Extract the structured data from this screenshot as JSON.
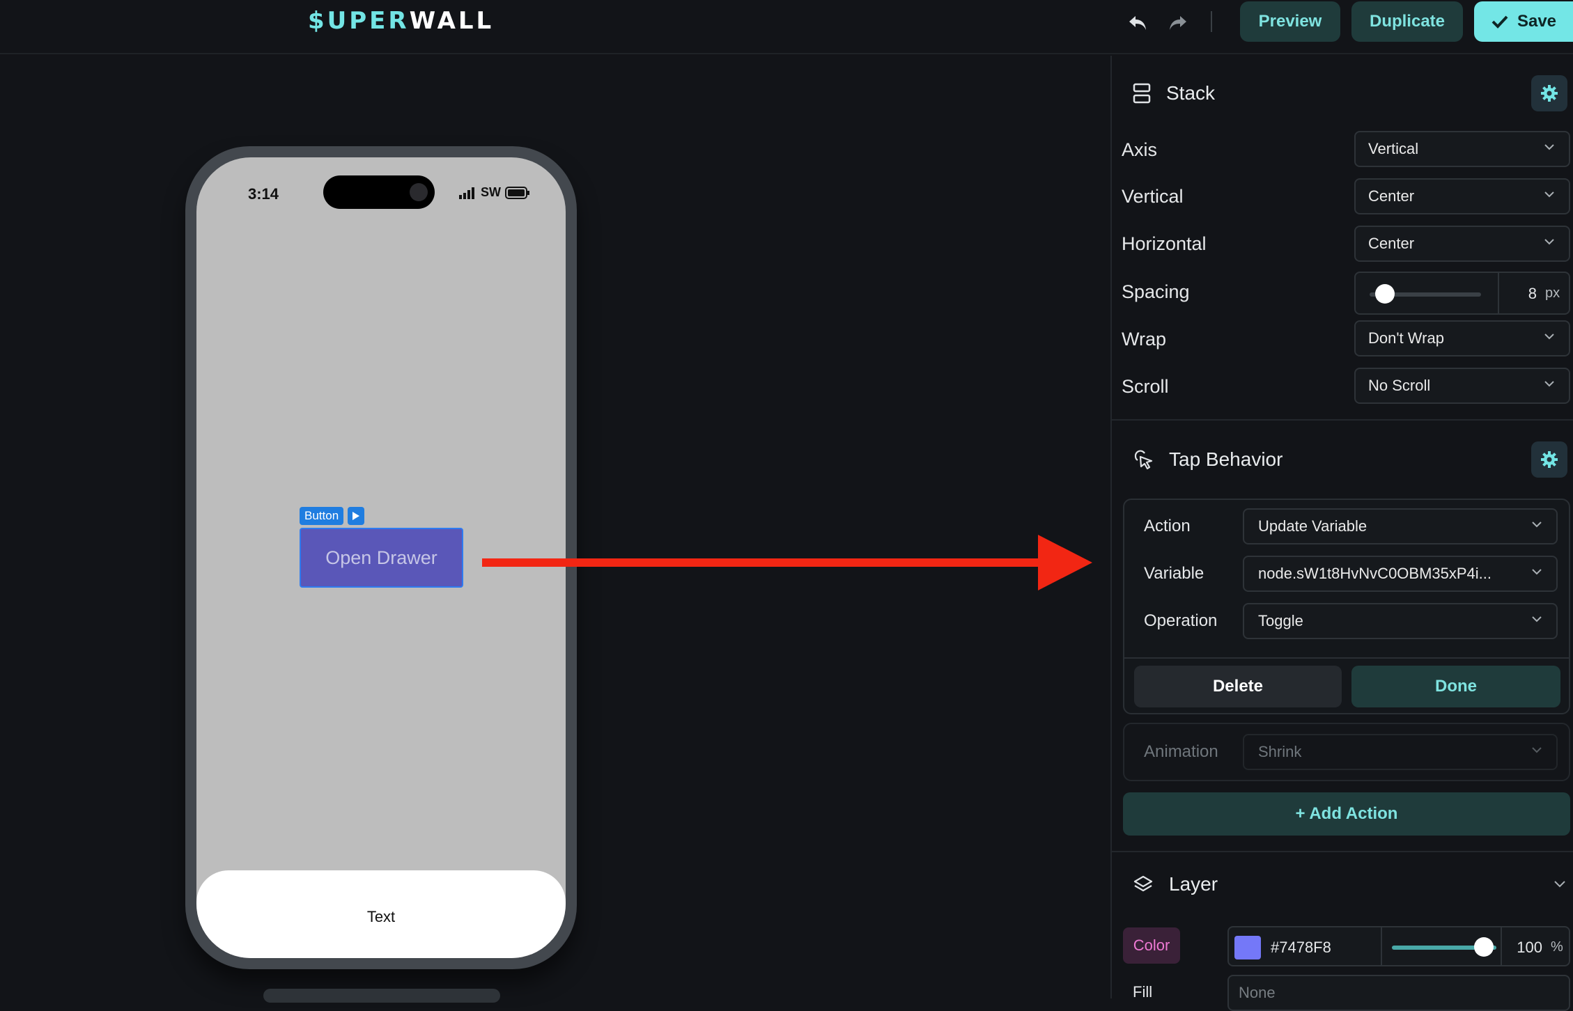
{
  "brand": {
    "logo_a": "$UPER",
    "logo_b": "WALL",
    "accent": "#73E5E5"
  },
  "toolbar": {
    "undo_icon": "undo-arrow-icon",
    "redo_icon": "redo-arrow-icon",
    "preview_label": "Preview",
    "duplicate_label": "Duplicate",
    "save_label": "Save"
  },
  "phone": {
    "time": "3:14",
    "carrier": "SW",
    "button_tag": "Button",
    "button_label": "Open Drawer",
    "button_color": "#5A57B8",
    "sheet_text": "Text"
  },
  "stack": {
    "title": "Stack",
    "axis_label": "Axis",
    "axis_value": "Vertical",
    "vertical_label": "Vertical",
    "vertical_value": "Center",
    "horizontal_label": "Horizontal",
    "horizontal_value": "Center",
    "spacing_label": "Spacing",
    "spacing_value": "8",
    "spacing_unit": "px",
    "spacing_slider_fraction": 0.05,
    "wrap_label": "Wrap",
    "wrap_value": "Don't Wrap",
    "scroll_label": "Scroll",
    "scroll_value": "No Scroll"
  },
  "tap": {
    "title": "Tap Behavior",
    "action_label": "Action",
    "action_value": "Update Variable",
    "variable_label": "Variable",
    "variable_value": "node.sW1t8HvNvC0OBM35xP4i...",
    "operation_label": "Operation",
    "operation_value": "Toggle",
    "delete_label": "Delete",
    "done_label": "Done",
    "animation_label": "Animation",
    "animation_value": "Shrink",
    "add_action_label": "+ Add Action"
  },
  "layer": {
    "title": "Layer",
    "color_label": "Color",
    "color_hex": "#7478F8",
    "opacity": "100",
    "opacity_unit": "%",
    "fill_label": "Fill",
    "fill_value": "None"
  }
}
